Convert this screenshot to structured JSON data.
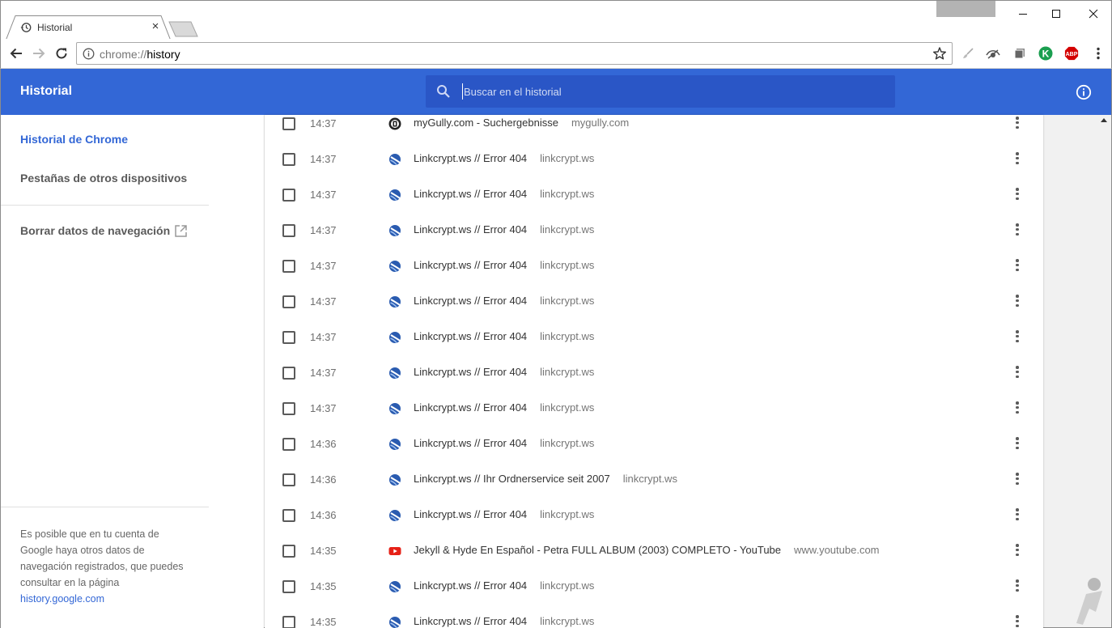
{
  "browser": {
    "tab_title": "Historial",
    "url_scheme": "chrome://",
    "url_path": "history",
    "extensions": [
      "brush-icon",
      "eye-icon",
      "layers-icon",
      "k-green-icon",
      "abp-icon"
    ],
    "abp_label": "ABP",
    "k_label": "K"
  },
  "header": {
    "title": "Historial",
    "search_placeholder": "Buscar en el historial"
  },
  "sidebar": {
    "items": [
      {
        "label": "Historial de Chrome",
        "active": true
      },
      {
        "label": "Pestañas de otros dispositivos",
        "active": false
      }
    ],
    "clear_label": "Borrar datos de navegación",
    "footer_text": "Es posible que en tu cuenta de Google haya otros datos de navegación registrados, que puedes consultar en la página",
    "footer_link": "history.google.com"
  },
  "history": [
    {
      "time": "14:37",
      "favicon": "mygully",
      "title": "myGully.com - Suchergebnisse",
      "domain": "mygully.com"
    },
    {
      "time": "14:37",
      "favicon": "linkcrypt",
      "title": "Linkcrypt.ws // Error 404",
      "domain": "linkcrypt.ws"
    },
    {
      "time": "14:37",
      "favicon": "linkcrypt",
      "title": "Linkcrypt.ws // Error 404",
      "domain": "linkcrypt.ws"
    },
    {
      "time": "14:37",
      "favicon": "linkcrypt",
      "title": "Linkcrypt.ws // Error 404",
      "domain": "linkcrypt.ws"
    },
    {
      "time": "14:37",
      "favicon": "linkcrypt",
      "title": "Linkcrypt.ws // Error 404",
      "domain": "linkcrypt.ws"
    },
    {
      "time": "14:37",
      "favicon": "linkcrypt",
      "title": "Linkcrypt.ws // Error 404",
      "domain": "linkcrypt.ws"
    },
    {
      "time": "14:37",
      "favicon": "linkcrypt",
      "title": "Linkcrypt.ws // Error 404",
      "domain": "linkcrypt.ws"
    },
    {
      "time": "14:37",
      "favicon": "linkcrypt",
      "title": "Linkcrypt.ws // Error 404",
      "domain": "linkcrypt.ws"
    },
    {
      "time": "14:37",
      "favicon": "linkcrypt",
      "title": "Linkcrypt.ws // Error 404",
      "domain": "linkcrypt.ws"
    },
    {
      "time": "14:36",
      "favicon": "linkcrypt",
      "title": "Linkcrypt.ws // Error 404",
      "domain": "linkcrypt.ws"
    },
    {
      "time": "14:36",
      "favicon": "linkcrypt",
      "title": "Linkcrypt.ws // Ihr Ordnerservice seit 2007",
      "domain": "linkcrypt.ws"
    },
    {
      "time": "14:36",
      "favicon": "linkcrypt",
      "title": "Linkcrypt.ws // Error 404",
      "domain": "linkcrypt.ws"
    },
    {
      "time": "14:35",
      "favicon": "youtube",
      "title": "Jekyll & Hyde En Español - Petra FULL ALBUM (2003) COMPLETO - YouTube",
      "domain": "www.youtube.com"
    },
    {
      "time": "14:35",
      "favicon": "linkcrypt",
      "title": "Linkcrypt.ws // Error 404",
      "domain": "linkcrypt.ws"
    },
    {
      "time": "14:35",
      "favicon": "linkcrypt",
      "title": "Linkcrypt.ws // Error 404",
      "domain": "linkcrypt.ws"
    }
  ],
  "colors": {
    "header_blue": "#3367d6",
    "search_blue": "#2a56c6",
    "youtube_red": "#e62117",
    "abp_red": "#d40000",
    "k_green": "#1a9e4f"
  }
}
